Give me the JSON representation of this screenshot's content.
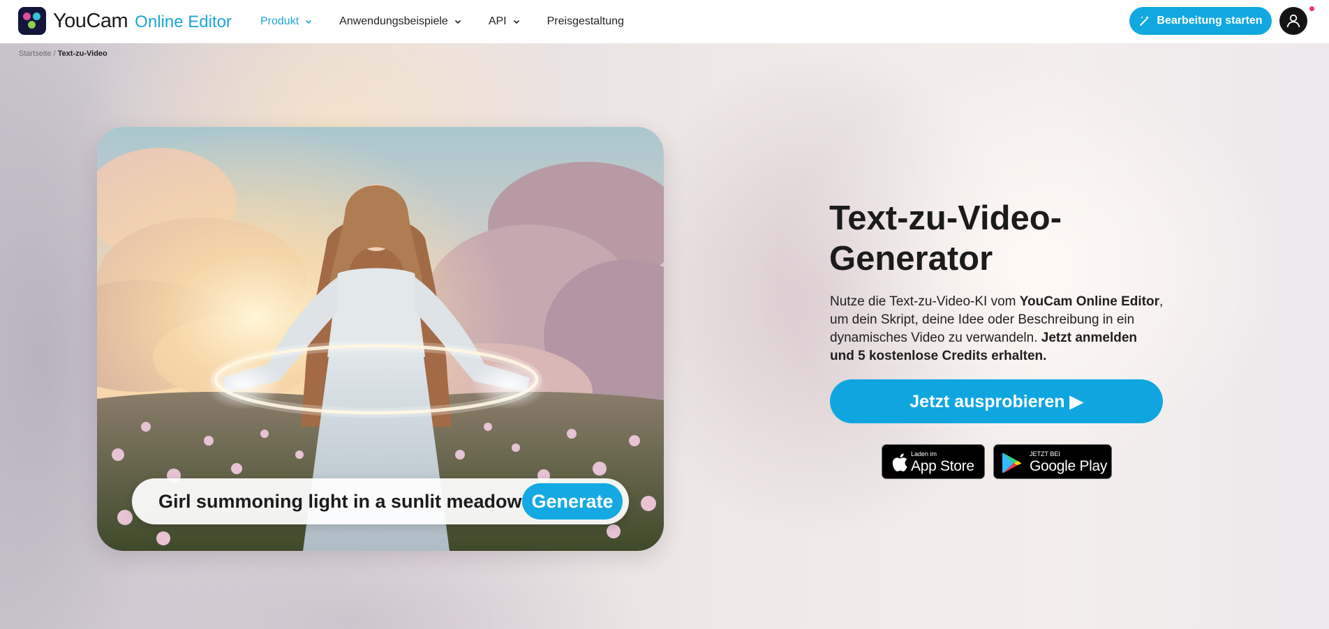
{
  "header": {
    "logo_brand": "YouCam",
    "logo_sub": "Online Editor",
    "nav": [
      {
        "label": "Produkt"
      },
      {
        "label": "Anwendungsbeispiele"
      },
      {
        "label": "API"
      },
      {
        "label": "Preisgestaltung"
      }
    ],
    "start_button": "Bearbeitung starten"
  },
  "breadcrumb": {
    "home": "Startseite",
    "separator": "/",
    "current": "Text-zu-Video"
  },
  "hero": {
    "prompt_text": "Girl summoning light in a sunlit meadow",
    "generate_label": "Generate"
  },
  "main": {
    "title": "Text-zu-Video-Generator",
    "desc_1": "Nutze die Text-zu-Video-KI vom ",
    "desc_2": "YouCam Online Editor",
    "desc_3": ", um dein Skript, deine Idee oder Beschreibung in ein dynamisches Video zu verwandeln. ",
    "desc_4": "Jetzt anmelden und 5 kostenlose Credits erhalten.",
    "cta_label": "Jetzt ausprobieren ▶"
  },
  "stores": {
    "app_small": "Laden im",
    "app_big": "App Store",
    "play_small": "JETZT BEI",
    "play_big": "Google Play"
  },
  "colors": {
    "accent": "#11a8e0",
    "active_nav": "#1ea5d6",
    "notification": "#f0306a"
  }
}
